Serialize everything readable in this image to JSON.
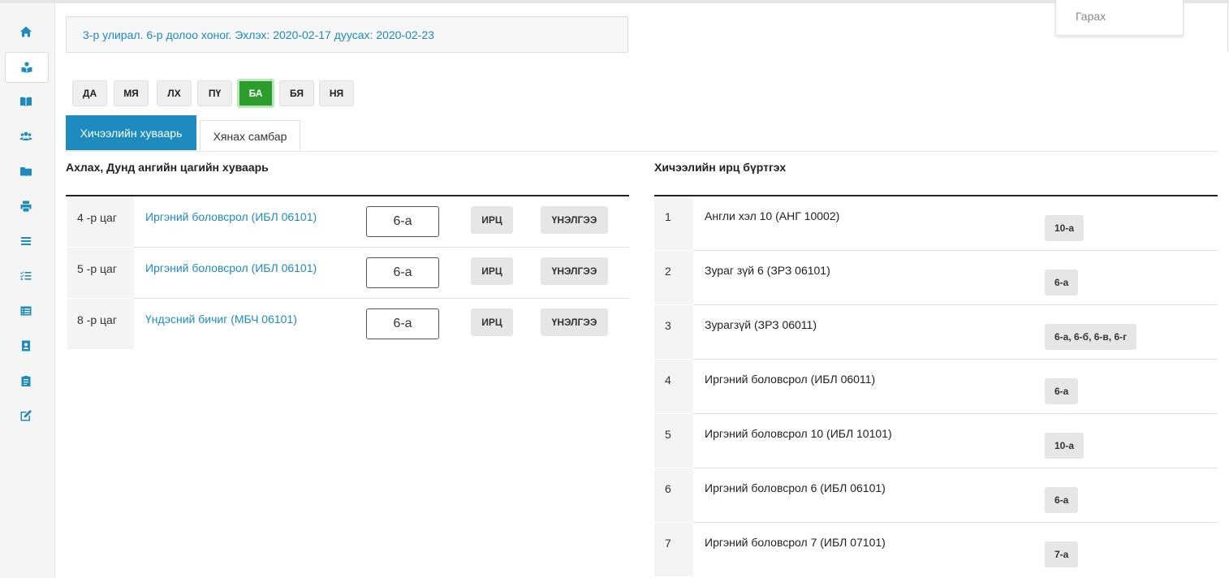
{
  "dropdown": {
    "logout": "Гарах"
  },
  "info": {
    "text": "3-р улирал. 6-р долоо хоног. Эхлэх: 2020-02-17 дуусах: 2020-02-23"
  },
  "days": [
    "ДА",
    "МЯ",
    "ЛХ",
    "ПҮ",
    "БА",
    "БЯ",
    "НЯ"
  ],
  "active_day": "БА",
  "tabs": {
    "schedule": "Хичээлийн хуваарь",
    "dashboard": "Хянах самбар"
  },
  "left": {
    "title": "Ахлах, Дунд ангийн цагийн хуваарь",
    "attendance_label": "ИРЦ",
    "grade_label": "ҮНЭЛГЭЭ",
    "rows": [
      {
        "time": "4 -р цаг",
        "subject": "Иргэний боловсрол (ИБЛ 06101)",
        "class": "6-а"
      },
      {
        "time": "5 -р цаг",
        "subject": "Иргэний боловсрол (ИБЛ 06101)",
        "class": "6-а"
      },
      {
        "time": "8 -р цаг",
        "subject": "Үндэсний бичиг (МБЧ 06101)",
        "class": "6-а"
      }
    ]
  },
  "right": {
    "title": "Хичээлийн ирц бүртгэх",
    "rows": [
      {
        "num": "1",
        "name": "Англи хэл 10 (АНГ 10002)",
        "classes": "10-а"
      },
      {
        "num": "2",
        "name": "Зураг зүй 6 (ЗРЗ 06101)",
        "classes": "6-а"
      },
      {
        "num": "3",
        "name": "Зурагзүй (ЗРЗ 06011)",
        "classes": "6-а, 6-б, 6-в, 6-г"
      },
      {
        "num": "4",
        "name": "Иргэний боловсрол (ИБЛ 06011)",
        "classes": "6-а"
      },
      {
        "num": "5",
        "name": "Иргэний боловсрол 10 (ИБЛ 10101)",
        "classes": "10-а"
      },
      {
        "num": "6",
        "name": "Иргэний боловсрол 6 (ИБЛ 06101)",
        "classes": "6-а"
      },
      {
        "num": "7",
        "name": "Иргэний боловсрол 7 (ИБЛ 07101)",
        "classes": "7-а"
      }
    ]
  },
  "sidebar": {
    "icons": [
      "home-icon",
      "reader-icon",
      "book-icon",
      "users-icon",
      "folder-icon",
      "print-icon",
      "list-icon",
      "checklist-icon",
      "table-list-icon",
      "contact-icon",
      "clipboard-icon",
      "edit-icon"
    ]
  },
  "colors": {
    "accent": "#1d8bc0",
    "active_day": "#2a9d2a"
  }
}
